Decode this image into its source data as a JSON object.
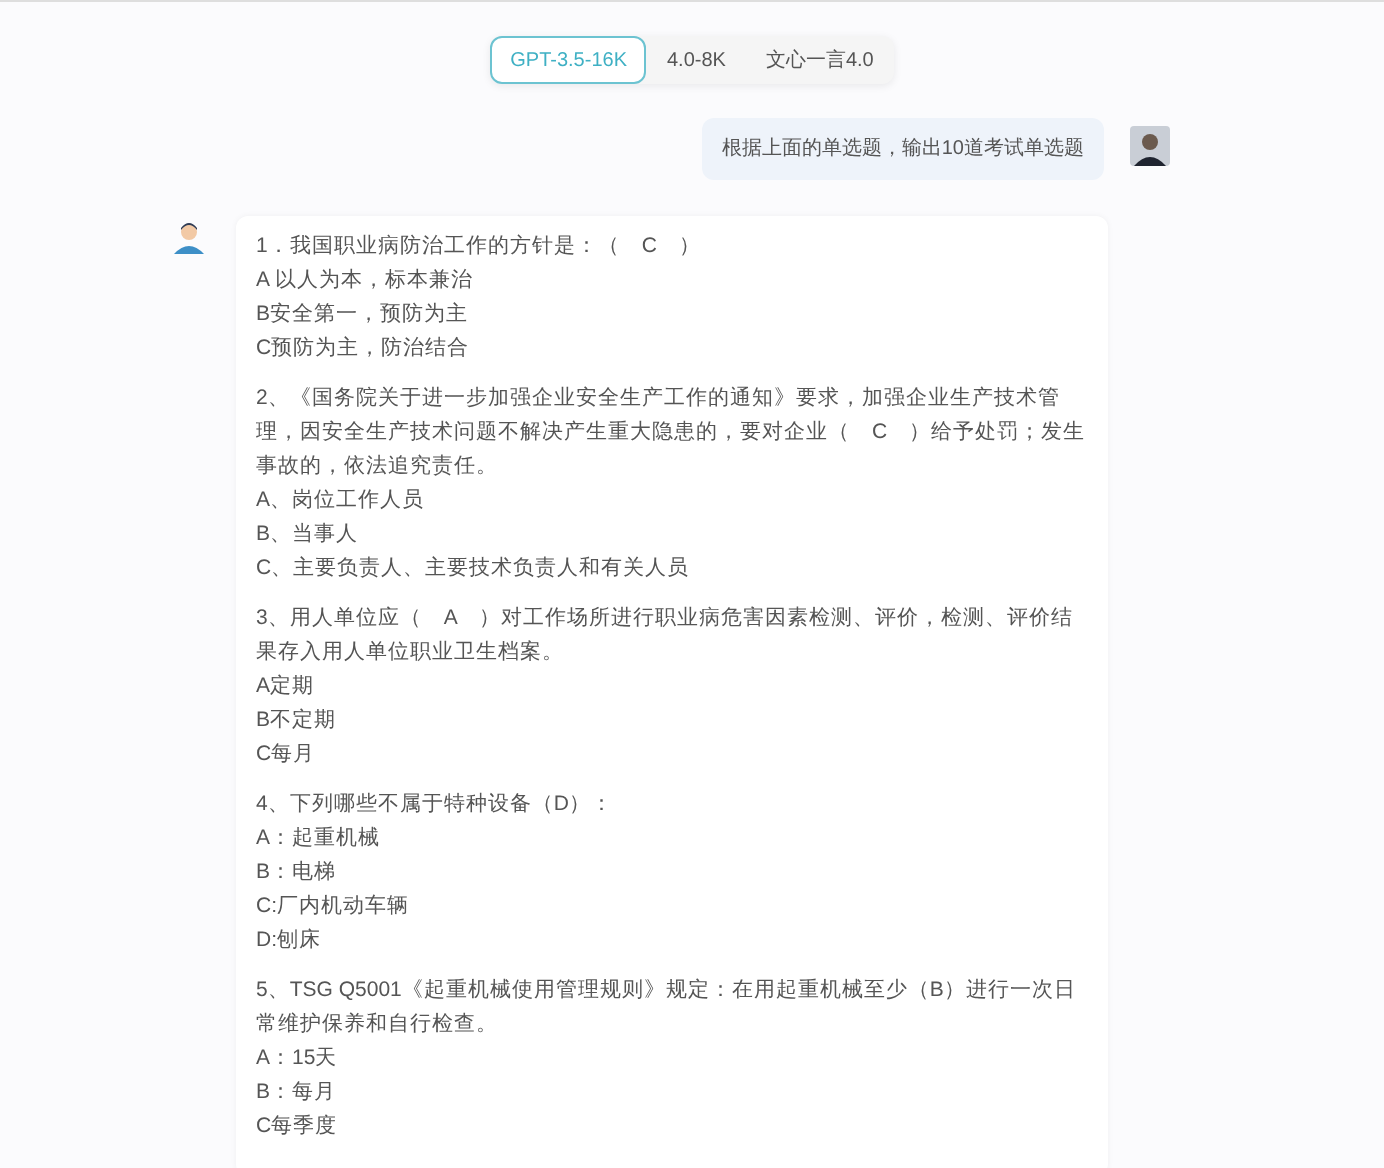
{
  "model_tabs": [
    {
      "label": "GPT-3.5-16K",
      "selected": true
    },
    {
      "label": "4.0-8K",
      "selected": false
    },
    {
      "label": "文心一言4.0",
      "selected": false
    }
  ],
  "user_message": {
    "text": "根据上面的单选题，输出10道考试单选题"
  },
  "answer": {
    "questions": [
      {
        "stem": "1．我国职业病防治工作的方针是：（　C　）",
        "options": [
          "A 以人为本，标本兼治",
          "B安全第一，预防为主",
          "C预防为主，防治结合"
        ]
      },
      {
        "stem": "2、《国务院关于进一步加强企业安全生产工作的通知》要求，加强企业生产技术管理，因安全生产技术问题不解决产生重大隐患的，要对企业（　C　）给予处罚；发生事故的，依法追究责任。",
        "options": [
          "A、岗位工作人员",
          "B、当事人",
          "C、主要负责人、主要技术负责人和有关人员"
        ]
      },
      {
        "stem": "3、用人单位应（　A　）对工作场所进行职业病危害因素检测、评价，检测、评价结果存入用人单位职业卫生档案。",
        "options": [
          "A定期",
          "B不定期",
          "C每月"
        ]
      },
      {
        "stem": "4、下列哪些不属于特种设备（D）：",
        "options": [
          "A：起重机械",
          "B：电梯",
          "C:厂内机动车辆",
          "D:刨床"
        ]
      },
      {
        "stem": "5、TSG Q5001《起重机械使用管理规则》规定：在用起重机械至少（B）进行一次日常维护保养和自行检查。",
        "options": [
          "A：15天",
          "B：每月",
          "C每季度"
        ]
      }
    ]
  }
}
